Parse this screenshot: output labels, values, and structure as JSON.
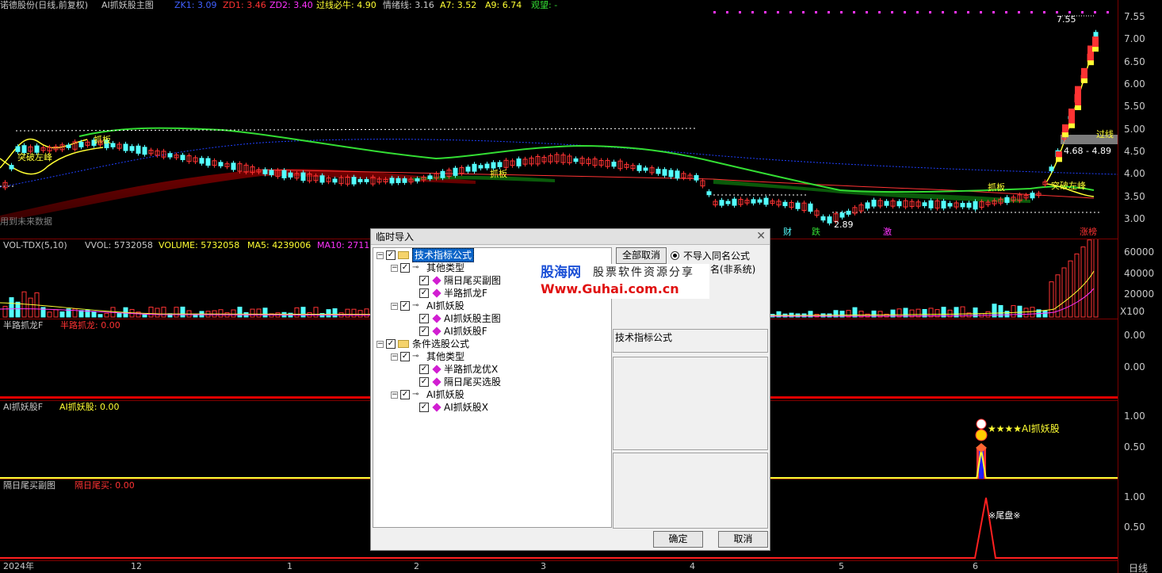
{
  "chart_header": {
    "stock": "诺德股份(日线,前复权)",
    "indicator": "AI抓妖股主图",
    "zk1": "ZK1: 3.09",
    "zd1": "ZD1: 3.46",
    "zd2": "ZD2: 3.40",
    "guoxian": "过线必牛: 4.90",
    "qingxu": "情绪线: 3.16",
    "a7": "A7: 3.52",
    "a9": "A9: 6.74",
    "guanwang": "观望: -"
  },
  "main_labels": {
    "tupo1": "突破左峰",
    "zhuaban1": "抓板",
    "zhuaban2": "抓板",
    "zhuaban3": "抓板",
    "tupo2": "突破左峰",
    "guoxian_tag": "过线",
    "range_tag": "4.68 - 4.89",
    "high_tag": "7.55",
    "low_tag": "2.89",
    "future": "用到未来数据",
    "cai": "财",
    "die": "跌",
    "ji": "激",
    "zhangting": "涨榜"
  },
  "vol_header": {
    "name": "VOL-TDX(5,10)",
    "vvol": "VVOL: 5732058",
    "volume": "VOLUME: 5732058",
    "ma5": "MA5: 4239006",
    "ma10": "MA10: 2711"
  },
  "panel3": {
    "name": "半路抓龙F",
    "value": "半路抓龙: 0.00"
  },
  "panel4": {
    "name": "AI抓妖股F",
    "value": "AI抓妖股: 0.00",
    "signal": "★★★★AI抓妖股"
  },
  "panel5": {
    "name": "隔日尾买副图",
    "value": "隔日尾买: 0.00",
    "signal": "※尾盘※"
  },
  "axis_main": [
    "7.55",
    "7.00",
    "6.50",
    "6.00",
    "5.50",
    "5.00",
    "4.50",
    "4.00",
    "3.50",
    "3.00"
  ],
  "axis_vol": [
    "60000",
    "40000",
    "20000",
    "X100"
  ],
  "axis_p3": [
    "0.00",
    "0.00"
  ],
  "axis_p4": [
    "1.00",
    "0.50"
  ],
  "axis_p5": [
    "1.00",
    "0.50"
  ],
  "time_axis": [
    "2024年",
    "12",
    "1",
    "2",
    "3",
    "4",
    "5",
    "6",
    "日线"
  ],
  "dialog": {
    "title": "临时导入",
    "tree": {
      "root1": "技术指标公式",
      "other1": "其他类型",
      "item1": "隔日尾买副图",
      "item2": "半路抓龙F",
      "ai1": "AI抓妖股",
      "item3": "AI抓妖股主图",
      "item4": "AI抓妖股F",
      "root2": "条件选股公式",
      "other2": "其他类型",
      "item5": "半路抓龙优X",
      "item6": "隔日尾买选股",
      "ai2": "AI抓妖股",
      "item7": "AI抓妖股X"
    },
    "cancel_all": "全部取消",
    "radio1": "不导入同名公式",
    "radio2_tail": "名(非系统)",
    "type_label": "技术指标公式",
    "ok": "确定",
    "cancel": "取消"
  },
  "watermark": {
    "brand": "股海网",
    "slogan": "股票软件资源分享",
    "url": "Www.Guhai.com.cn"
  },
  "colors": {
    "red": "#ff3333",
    "cyan": "#54ffff",
    "yellow": "#ffff33",
    "green": "#33dd33",
    "magenta": "#ff33ff",
    "axis_red": "#7a0000"
  }
}
